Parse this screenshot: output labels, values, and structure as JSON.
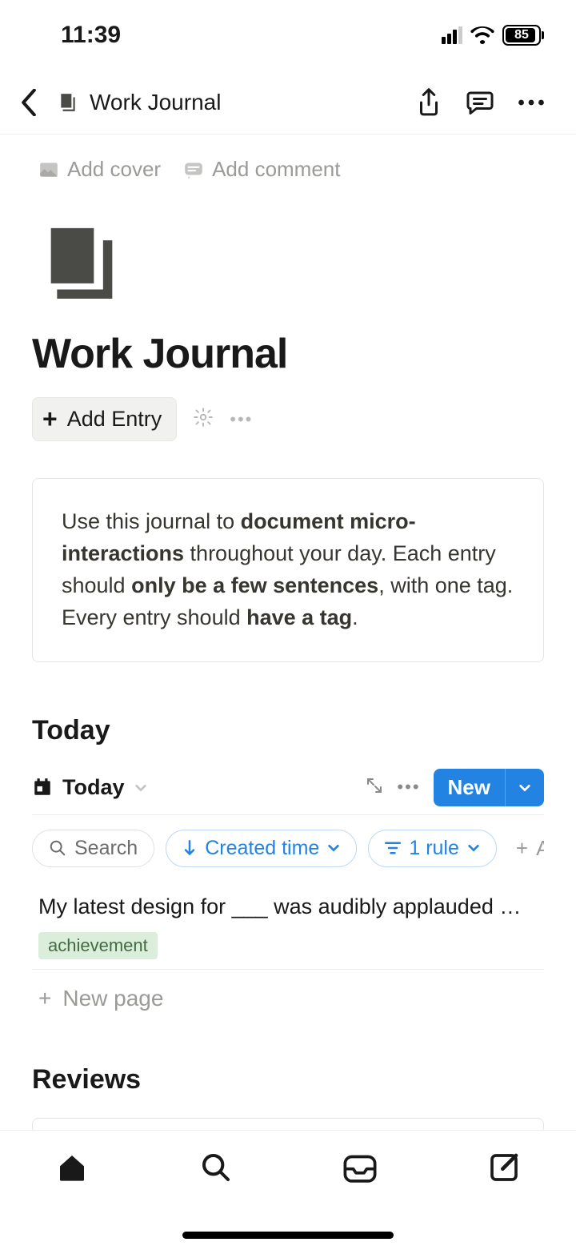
{
  "status": {
    "time": "11:39",
    "battery": "85"
  },
  "nav": {
    "breadcrumb": "Work Journal"
  },
  "meta": {
    "add_cover": "Add cover",
    "add_comment": "Add comment"
  },
  "page": {
    "title": "Work Journal",
    "add_entry": "Add Entry"
  },
  "callout": {
    "p1a": "Use this journal to ",
    "p1b": "document micro-interactions",
    "p1c": " throughout your day. Each entry should ",
    "p1d": "only be a few sentences",
    "p1e": ", with one tag. Every entry should ",
    "p1f": "have a tag",
    "p1g": "."
  },
  "today": {
    "label": "Today",
    "tab": "Today",
    "new_btn": "New",
    "search": "Search",
    "sort": "Created time",
    "rule": "1 rule",
    "add_filter": "Add fi",
    "entry_title": "My latest design for ___ was audibly applauded …",
    "entry_tag": "achievement",
    "new_page": "New page"
  },
  "reviews": {
    "label": "Reviews"
  }
}
